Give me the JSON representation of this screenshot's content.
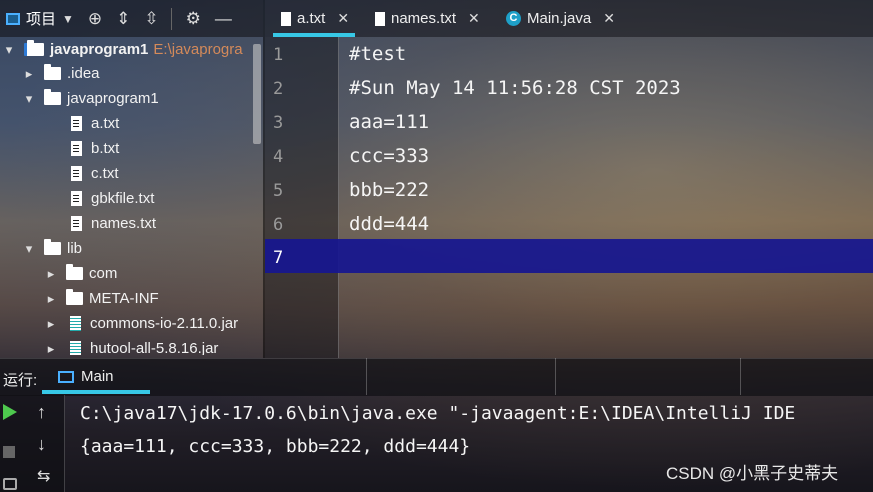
{
  "project": {
    "title": "项目",
    "tree": [
      {
        "label": "javaprogram1",
        "hint": "E:\\javaprogra",
        "type": "module",
        "arrow": "▾"
      },
      {
        "label": ".idea",
        "type": "folder",
        "arrow": "▸"
      },
      {
        "label": "javaprogram1",
        "type": "folder",
        "arrow": "▾"
      },
      {
        "label": "a.txt",
        "type": "file"
      },
      {
        "label": "b.txt",
        "type": "file"
      },
      {
        "label": "c.txt",
        "type": "file"
      },
      {
        "label": "gbkfile.txt",
        "type": "file"
      },
      {
        "label": "names.txt",
        "type": "file"
      },
      {
        "label": "lib",
        "type": "folder",
        "arrow": "▾"
      },
      {
        "label": "com",
        "type": "folder",
        "arrow": "▸"
      },
      {
        "label": "META-INF",
        "type": "folder",
        "arrow": "▸"
      },
      {
        "label": "commons-io-2.11.0.jar",
        "type": "jar",
        "arrow": "▸"
      },
      {
        "label": "hutool-all-5.8.16.jar",
        "type": "jar",
        "arrow": "▸"
      }
    ]
  },
  "editor": {
    "tabs": [
      {
        "label": "a.txt",
        "active": true
      },
      {
        "label": "names.txt",
        "active": false
      },
      {
        "label": "Main.java",
        "active": false
      }
    ],
    "lines": [
      {
        "num": "1",
        "text": "#test"
      },
      {
        "num": "2",
        "text": "#Sun May 14 11:56:28 CST 2023"
      },
      {
        "num": "3",
        "text": "aaa=111"
      },
      {
        "num": "4",
        "text": "ccc=333"
      },
      {
        "num": "5",
        "text": "bbb=222"
      },
      {
        "num": "6",
        "text": "ddd=444"
      },
      {
        "num": "7",
        "text": ""
      }
    ],
    "current_line": "7"
  },
  "run": {
    "label": "运行:",
    "tab": "Main",
    "console": [
      "C:\\java17\\jdk-17.0.6\\bin\\java.exe \"-javaagent:E:\\IDEA\\IntelliJ IDE",
      "{aaa=111, ccc=333, bbb=222, ddd=444}"
    ]
  },
  "watermark": "CSDN @小黑子史蒂夫",
  "colors": {
    "accent": "#37c8e6",
    "caret_line": "#161690",
    "run_green": "#4ec94e"
  }
}
